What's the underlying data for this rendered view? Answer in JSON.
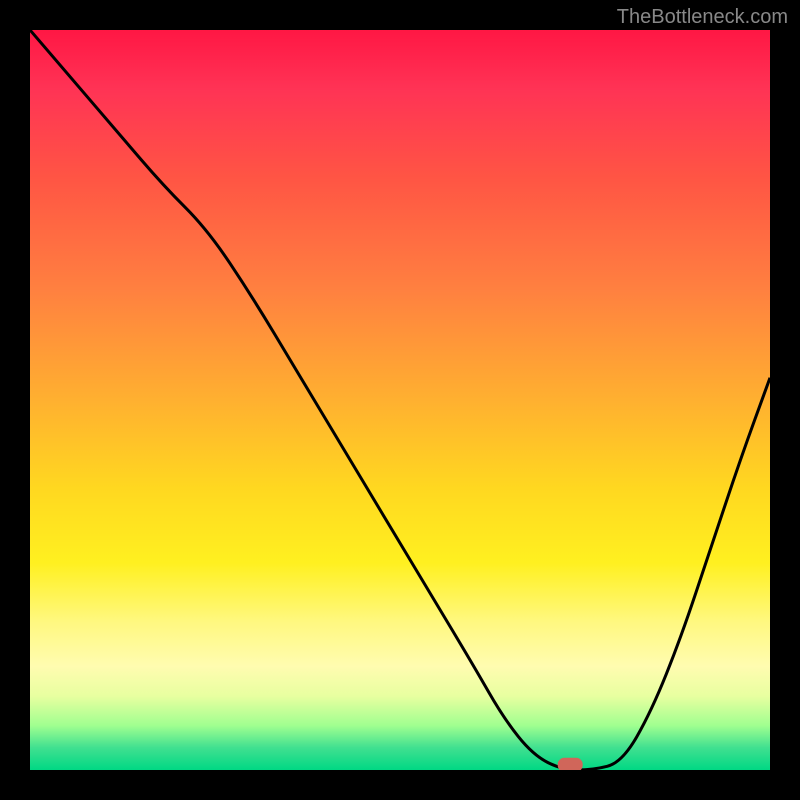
{
  "watermark": "TheBottleneck.com",
  "chart_data": {
    "type": "line",
    "title": "",
    "xlabel": "",
    "ylabel": "",
    "xlim": [
      0,
      100
    ],
    "ylim": [
      0,
      100
    ],
    "series": [
      {
        "name": "curve",
        "x": [
          0,
          6,
          12,
          18,
          24,
          30,
          36,
          42,
          48,
          54,
          60,
          64,
          68,
          72,
          76,
          80,
          84,
          88,
          92,
          96,
          100
        ],
        "values": [
          100,
          93,
          86,
          79,
          73,
          64,
          54,
          44,
          34,
          24,
          14,
          7,
          2,
          0,
          0,
          1,
          8,
          18,
          30,
          42,
          53
        ]
      }
    ],
    "marker": {
      "x": 73,
      "y": 0.5
    },
    "background_gradient": {
      "stops": [
        {
          "pos": 0.0,
          "color": "#ff1744"
        },
        {
          "pos": 0.35,
          "color": "#ff8040"
        },
        {
          "pos": 0.62,
          "color": "#ffd820"
        },
        {
          "pos": 0.86,
          "color": "#fffcb0"
        },
        {
          "pos": 1.0,
          "color": "#00d884"
        }
      ]
    }
  }
}
